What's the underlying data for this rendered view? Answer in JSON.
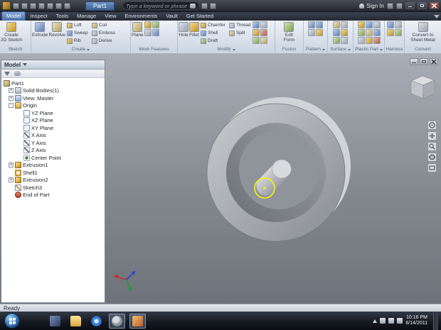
{
  "titlebar": {
    "doc_tab": "Part1",
    "search_placeholder": "Type a keyword or phrase",
    "sign_in": "Sign In"
  },
  "tabs": {
    "t0": "Model",
    "t1": "Inspect",
    "t2": "Tools",
    "t3": "Manage",
    "t4": "View",
    "t5": "Environments",
    "t6": "Vault",
    "t7": "Get Started"
  },
  "ribbon": {
    "sketch_label": "Sketch",
    "create_label": "Create",
    "work_label": "Work Features",
    "modify_label": "Modify",
    "fusion_label": "Fusion",
    "pattern_label": "Pattern",
    "surface_label": "Surface",
    "plastic_label": "Plastic Part",
    "harness_label": "Harness",
    "convert_label": "Convert",
    "create2d_l1": "Create",
    "create2d_l2": "2D Sketch",
    "extrude": "Extrude",
    "revolve": "Revolve",
    "loft": "Loft",
    "coil": "Coil",
    "sweep": "Sweep",
    "emboss": "Emboss",
    "rib": "Rib",
    "derive": "Derive",
    "plane": "Plane",
    "hole": "Hole",
    "fillet": "Fillet",
    "chamfer": "Chamfer",
    "thread": "Thread",
    "shell": "Shell",
    "split": "Split",
    "draft": "Draft",
    "editform_l1": "Edit",
    "editform_l2": "Form",
    "convert_l1": "Convert to",
    "convert_l2": "Sheet Metal"
  },
  "browser": {
    "header": "Model",
    "tree": [
      {
        "label": "Part1",
        "expand": ""
      },
      {
        "label": "Solid Bodies(1)",
        "expand": "+"
      },
      {
        "label": "View: Master",
        "expand": "+"
      },
      {
        "label": "Origin",
        "expand": "-"
      },
      {
        "label": "YZ Plane",
        "expand": ""
      },
      {
        "label": "XZ Plane",
        "expand": ""
      },
      {
        "label": "XY Plane",
        "expand": ""
      },
      {
        "label": "X Axis",
        "expand": ""
      },
      {
        "label": "Y Axis",
        "expand": ""
      },
      {
        "label": "Z Axis",
        "expand": ""
      },
      {
        "label": "Center Point",
        "expand": ""
      },
      {
        "label": "Extrusion1",
        "expand": "+"
      },
      {
        "label": "Shell1",
        "expand": ""
      },
      {
        "label": "Extrusion2",
        "expand": "+"
      },
      {
        "label": "Sketch3",
        "expand": ""
      },
      {
        "label": "End of Part",
        "expand": ""
      }
    ]
  },
  "statusbar": {
    "ready": "Ready"
  },
  "taskbar": {
    "time": "10:16 PM",
    "date": "6/14/2011"
  },
  "colors": {
    "accent_blue": "#4f79b8",
    "selection_highlight": "#ffff00",
    "viewport_gray": "#84888f"
  }
}
